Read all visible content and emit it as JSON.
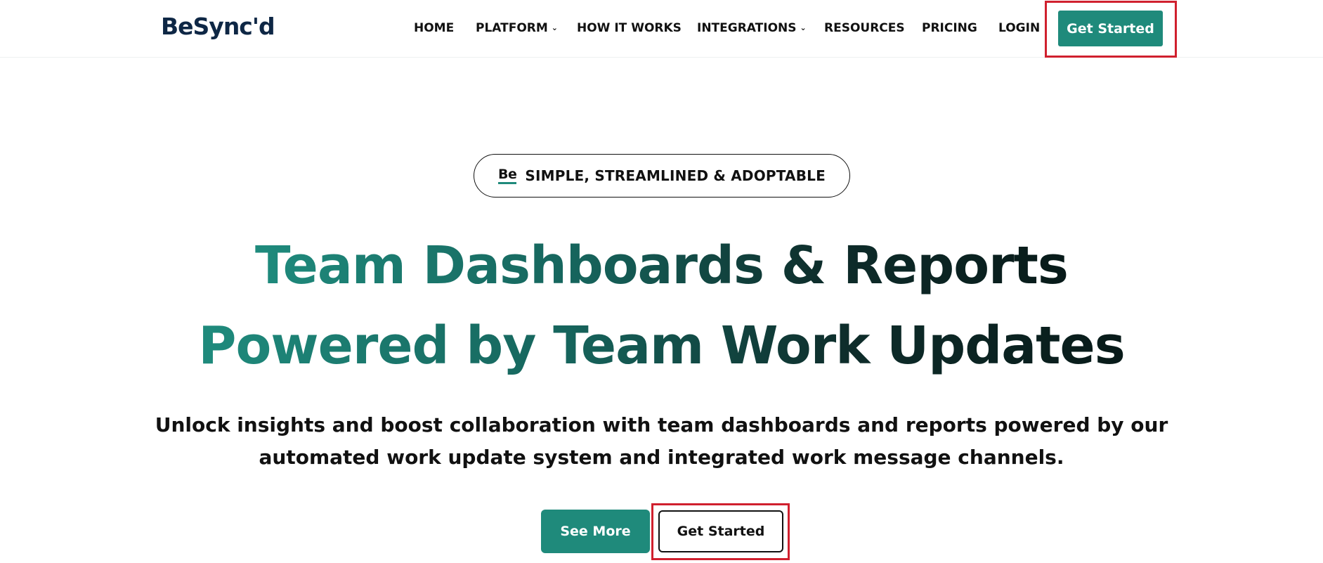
{
  "brand": {
    "logo_text": "BeSync'd",
    "accent_color": "#1f8a7b",
    "logo_color": "#0e2745"
  },
  "nav": {
    "items": [
      {
        "label": "HOME",
        "has_dropdown": false
      },
      {
        "label": "PLATFORM",
        "has_dropdown": true
      },
      {
        "label": "HOW IT WORKS",
        "has_dropdown": false
      },
      {
        "label": "INTEGRATIONS",
        "has_dropdown": true
      },
      {
        "label": "RESOURCES",
        "has_dropdown": false
      },
      {
        "label": "PRICING",
        "has_dropdown": false
      },
      {
        "label": "LOGIN",
        "has_dropdown": false
      }
    ],
    "cta_label": "Get Started",
    "dropdown_icon": "chevron-down-icon"
  },
  "hero": {
    "badge_logo": "Be",
    "badge_text": "SIMPLE, STREAMLINED & ADOPTABLE",
    "title_line1": "Team Dashboards & Reports",
    "title_line2": "Powered by Team Work Updates",
    "subtitle": "Unlock insights and boost collaboration with team dashboards and reports powered by our automated work update system and integrated work message channels.",
    "primary_button": "See More",
    "secondary_button": "Get Started"
  },
  "annotations": {
    "highlight_color": "#d0202e"
  }
}
